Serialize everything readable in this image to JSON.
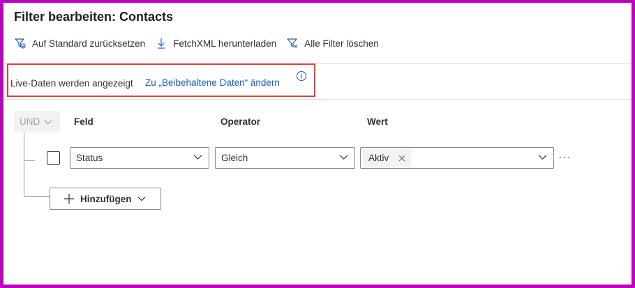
{
  "dialog": {
    "title": "Filter bearbeiten: Contacts"
  },
  "toolbar": {
    "reset_label": "Auf Standard zurücksetzen",
    "reset_icon": "filter-reset-icon",
    "download_label": "FetchXML herunterladen",
    "download_icon": "download-icon",
    "clear_label": "Alle Filter löschen",
    "clear_icon": "filter-clear-icon"
  },
  "notice": {
    "text": "Live-Daten werden angezeigt",
    "link": "Zu „Beibehaltene Daten“ ändern",
    "info_icon": "info-icon",
    "highlight_color": "#e0403a"
  },
  "filter": {
    "group_operator": "UND",
    "columns": {
      "field": "Feld",
      "operator": "Operator",
      "value": "Wert"
    },
    "rows": [
      {
        "field": "Status",
        "operator": "Gleich",
        "values": [
          "Aktiv"
        ]
      }
    ],
    "add_label": "Hinzufügen"
  },
  "colors": {
    "link": "#1a5fb4",
    "border": "#8a8886",
    "frame": "#c000c0"
  }
}
